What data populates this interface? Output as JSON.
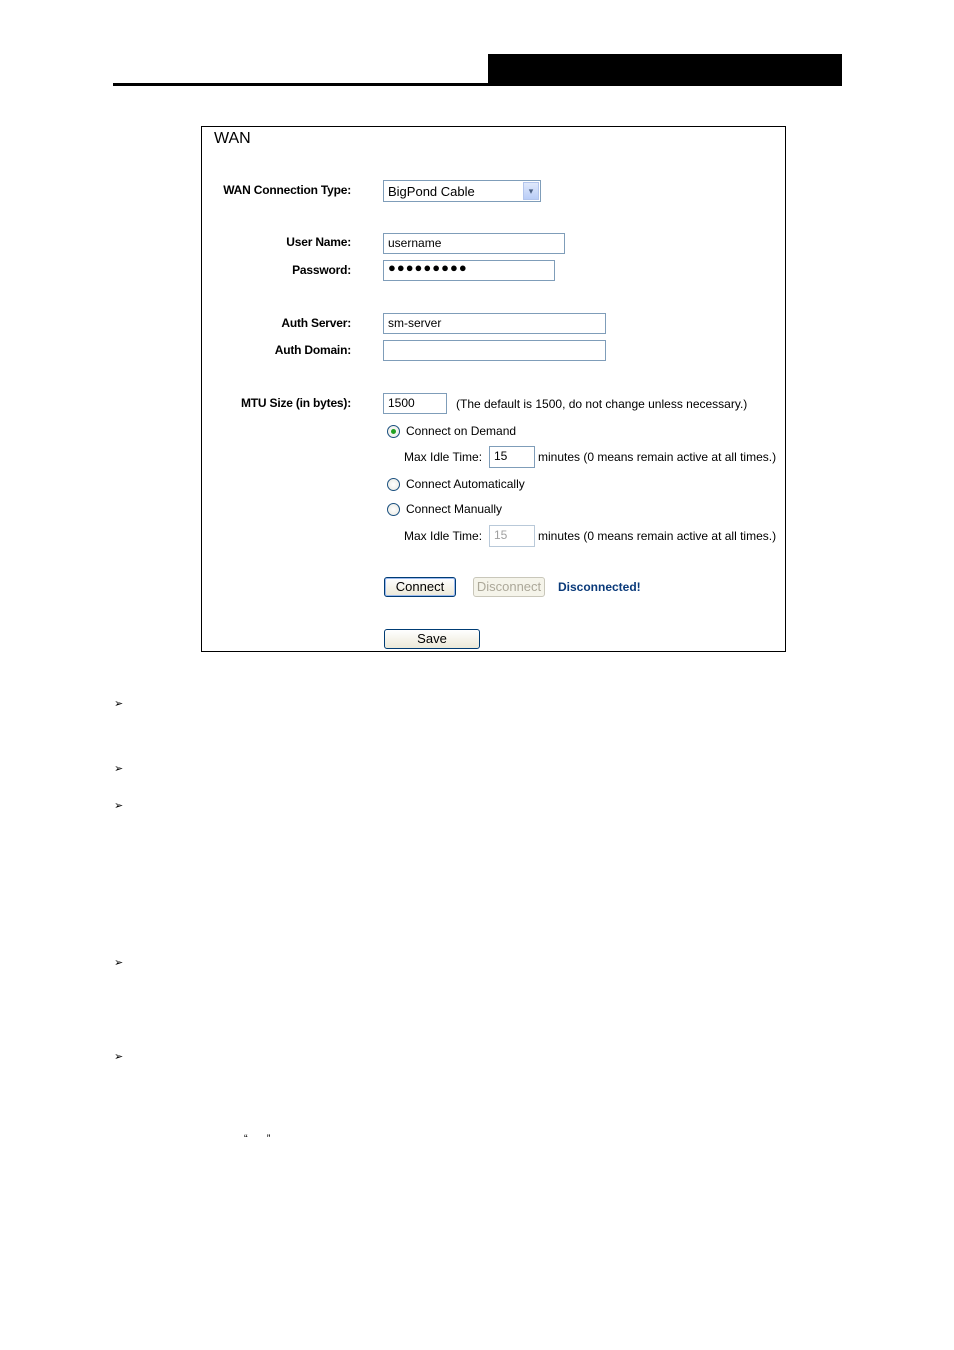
{
  "page": {
    "bullet_glyph": "➢",
    "quote_marks": "“ ”"
  },
  "wan": {
    "title": "WAN",
    "connection_type": {
      "label": "WAN Connection Type:",
      "value": "BigPond Cable",
      "arrow": "▾"
    },
    "user_name": {
      "label": "User Name:",
      "value": "username"
    },
    "password": {
      "label": "Password:",
      "value": "●●●●●●●●●"
    },
    "auth_server": {
      "label": "Auth Server:",
      "value": "sm-server"
    },
    "auth_domain": {
      "label": "Auth Domain:",
      "value": ""
    },
    "mtu": {
      "label": "MTU Size (in bytes):",
      "value": "1500",
      "hint": "(The default is 1500, do not change unless necessary.)"
    },
    "modes": [
      {
        "label": "Connect on Demand",
        "checked": true
      },
      {
        "label": "Connect Automatically",
        "checked": false
      },
      {
        "label": "Connect Manually",
        "checked": false
      }
    ],
    "idle_demand": {
      "label": "Max Idle Time:",
      "value": "15",
      "suffix": "minutes (0 means remain active at all times.)"
    },
    "idle_manual": {
      "label": "Max Idle Time:",
      "value": "15",
      "suffix": "minutes (0 means remain active at all times.)"
    },
    "connect_label": "Connect",
    "disconnect_label": "Disconnect",
    "status": "Disconnected!",
    "status_color": "#0a3a7a",
    "save_label": "Save"
  }
}
